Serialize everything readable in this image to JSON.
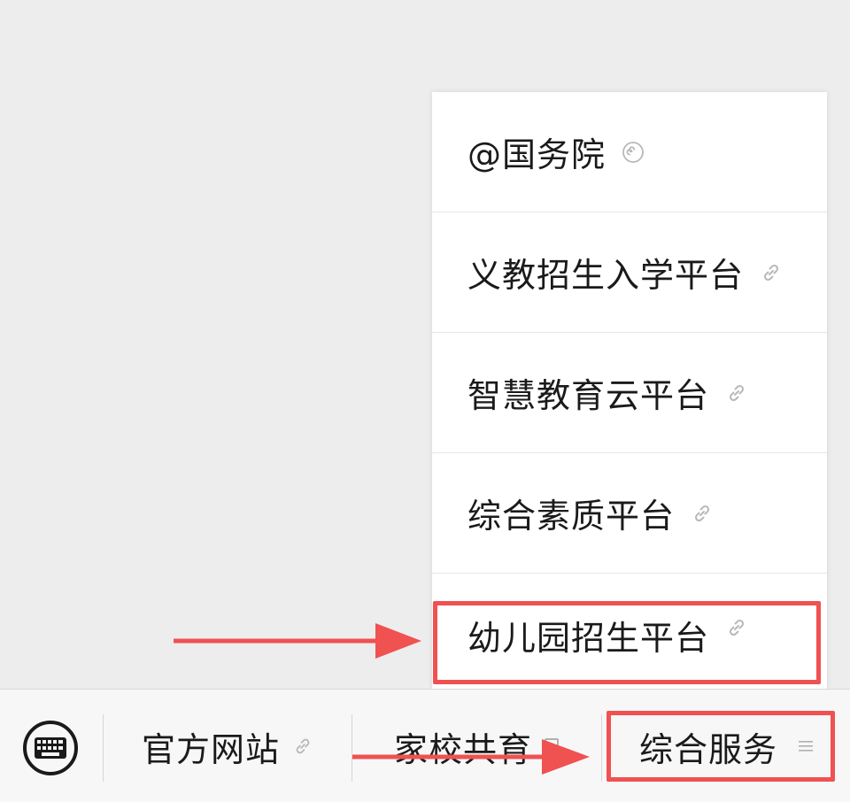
{
  "popup_menu": {
    "items": [
      {
        "label": "@国务院",
        "icon": "mini-program-icon"
      },
      {
        "label": "义教招生入学平台",
        "icon": "link-icon"
      },
      {
        "label": "智慧教育云平台",
        "icon": "link-icon"
      },
      {
        "label": "综合素质平台",
        "icon": "link-icon"
      },
      {
        "label": "幼儿园招生平台",
        "icon": "link-icon"
      }
    ]
  },
  "bottom_bar": {
    "keyboard_icon": "keyboard-icon",
    "items": [
      {
        "label": "官方网站",
        "icon": "link-icon"
      },
      {
        "label": "家校共育",
        "icon": "square-icon"
      },
      {
        "label": "综合服务",
        "icon": "menu-lines-icon"
      }
    ]
  },
  "colors": {
    "background": "#ededed",
    "annotation_red": "#f05151",
    "text": "#1a1a1a",
    "icon_gray": "#b0b0b0"
  }
}
